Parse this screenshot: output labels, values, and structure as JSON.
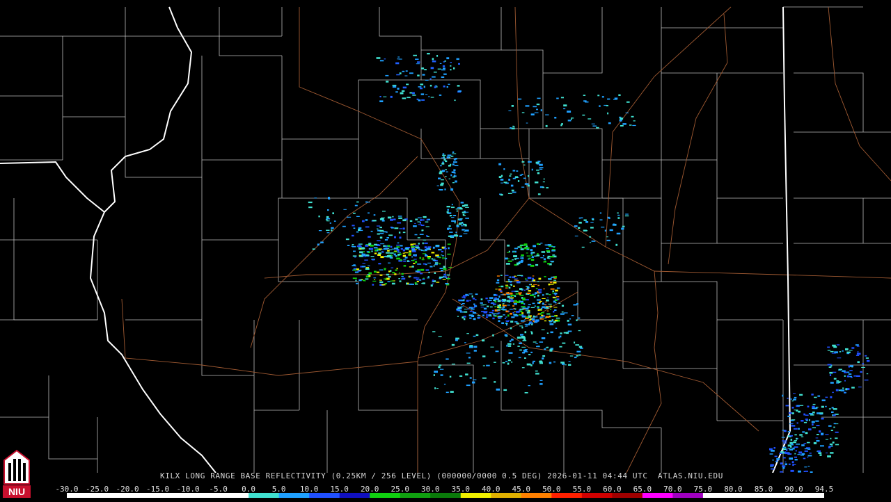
{
  "caption": {
    "product": "KILX LONG RANGE BASE REFLECTIVITY (0.25KM / 256 LEVEL) (000000/0000 0.5 DEG) 2026-01-11 04:44 UTC  ATLAS.NIU.EDU"
  },
  "logo": {
    "text": "NIU",
    "color": "#c8102e"
  },
  "colorbar": {
    "labels": [
      "-30.0",
      "-25.0",
      "-20.0",
      "-15.0",
      "-10.0",
      "-5.0",
      "0.0",
      "5.0",
      "10.0",
      "15.0",
      "20.0",
      "25.0",
      "30.0",
      "35.0",
      "40.0",
      "45.0",
      "50.0",
      "55.0",
      "60.0",
      "65.0",
      "70.0",
      "75.0",
      "80.0",
      "85.0",
      "90.0",
      "94.5"
    ],
    "colors": [
      "#ffffff",
      "#ffffff",
      "#ffffff",
      "#ffffff",
      "#ffffff",
      "#ffffff",
      "#40e0d0",
      "#1fa0ff",
      "#2050ff",
      "#1010c0",
      "#10d010",
      "#10a010",
      "#0a7a0a",
      "#f0f000",
      "#e0b000",
      "#ff8000",
      "#ff2000",
      "#d00000",
      "#a00000",
      "#ff00ff",
      "#a000c0",
      "#ffffff",
      "#ffffff",
      "#ffffff",
      "#ffffff"
    ]
  },
  "map_colors": {
    "county": "#bcbcbc",
    "state": "#ffffff",
    "road": "#a05a32",
    "background": "#000000"
  }
}
